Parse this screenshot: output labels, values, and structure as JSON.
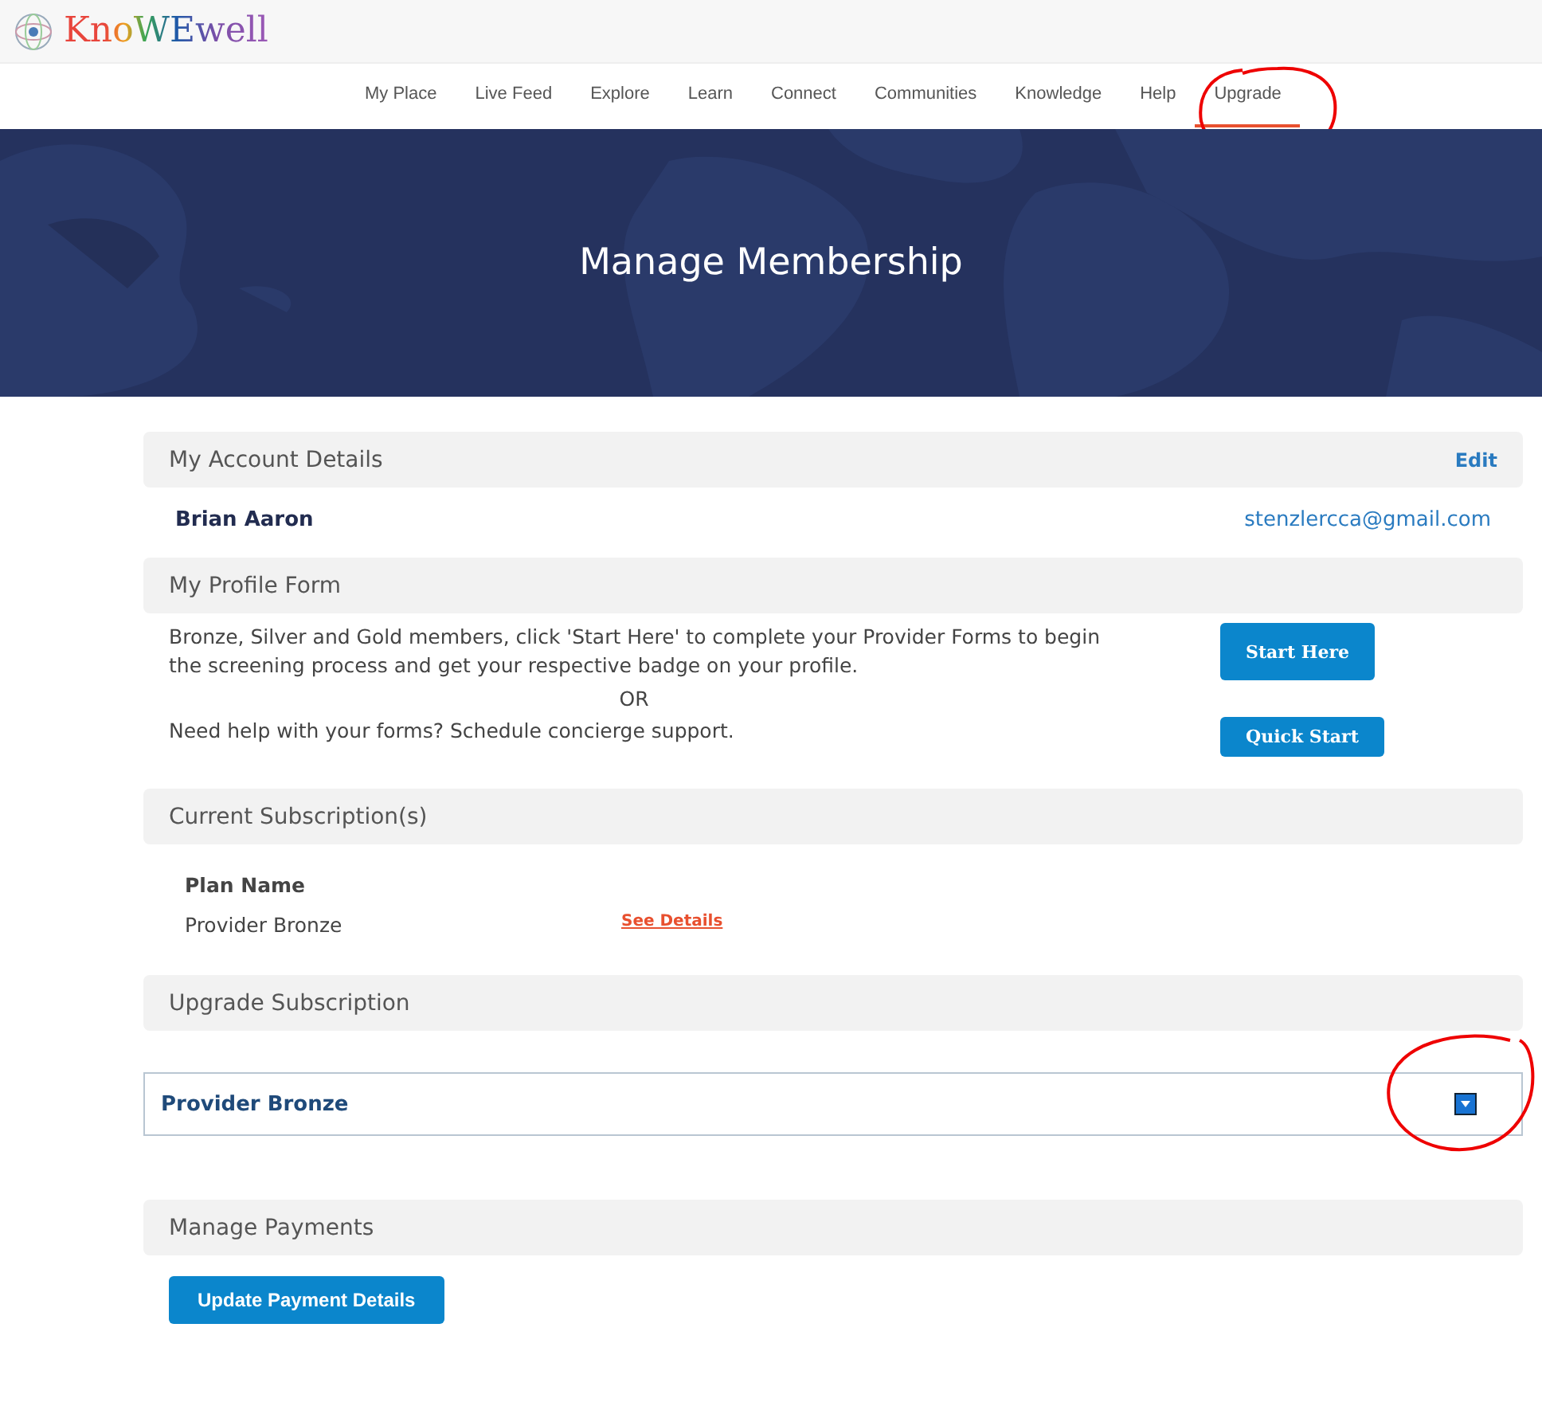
{
  "logo": {
    "text": "KnoWEwell"
  },
  "nav": [
    {
      "label": "My Place",
      "selected": false
    },
    {
      "label": "Live Feed",
      "selected": false
    },
    {
      "label": "Explore",
      "selected": false
    },
    {
      "label": "Learn",
      "selected": false
    },
    {
      "label": "Connect",
      "selected": false
    },
    {
      "label": "Communities",
      "selected": false
    },
    {
      "label": "Knowledge",
      "selected": false
    },
    {
      "label": "Help",
      "selected": false
    },
    {
      "label": "Upgrade",
      "selected": true
    }
  ],
  "banner": {
    "title": "Manage Membership",
    "kind": "picture"
  },
  "account": {
    "heading": "My Account Details",
    "edit": "Edit",
    "name": "Brian Aaron",
    "email": "stenzlercca@gmail.com"
  },
  "profile_form": {
    "heading": "My Profile Form",
    "rows": [
      {
        "text": "Bronze, Silver and Gold members, click 'Start Here' to complete your Provider Forms to begin the screening process and get your respective badge on your profile.",
        "button": "Start Here"
      },
      {
        "text": "Need help with your forms? Schedule concierge support.",
        "button": "Quick Start"
      }
    ],
    "separator": "OR"
  },
  "subscriptions": {
    "heading": "Current Subscription(s)",
    "column_header": "Plan Name",
    "plan": "Provider Bronze",
    "details_link": "See Details"
  },
  "upgrade": {
    "heading": "Upgrade Subscription",
    "select_value": "Provider Bronze"
  },
  "payments": {
    "heading": "Manage Payments",
    "button": "Update Payment Details"
  },
  "annotations": [
    {
      "kind": "circle"
    },
    {
      "kind": "circle"
    }
  ]
}
